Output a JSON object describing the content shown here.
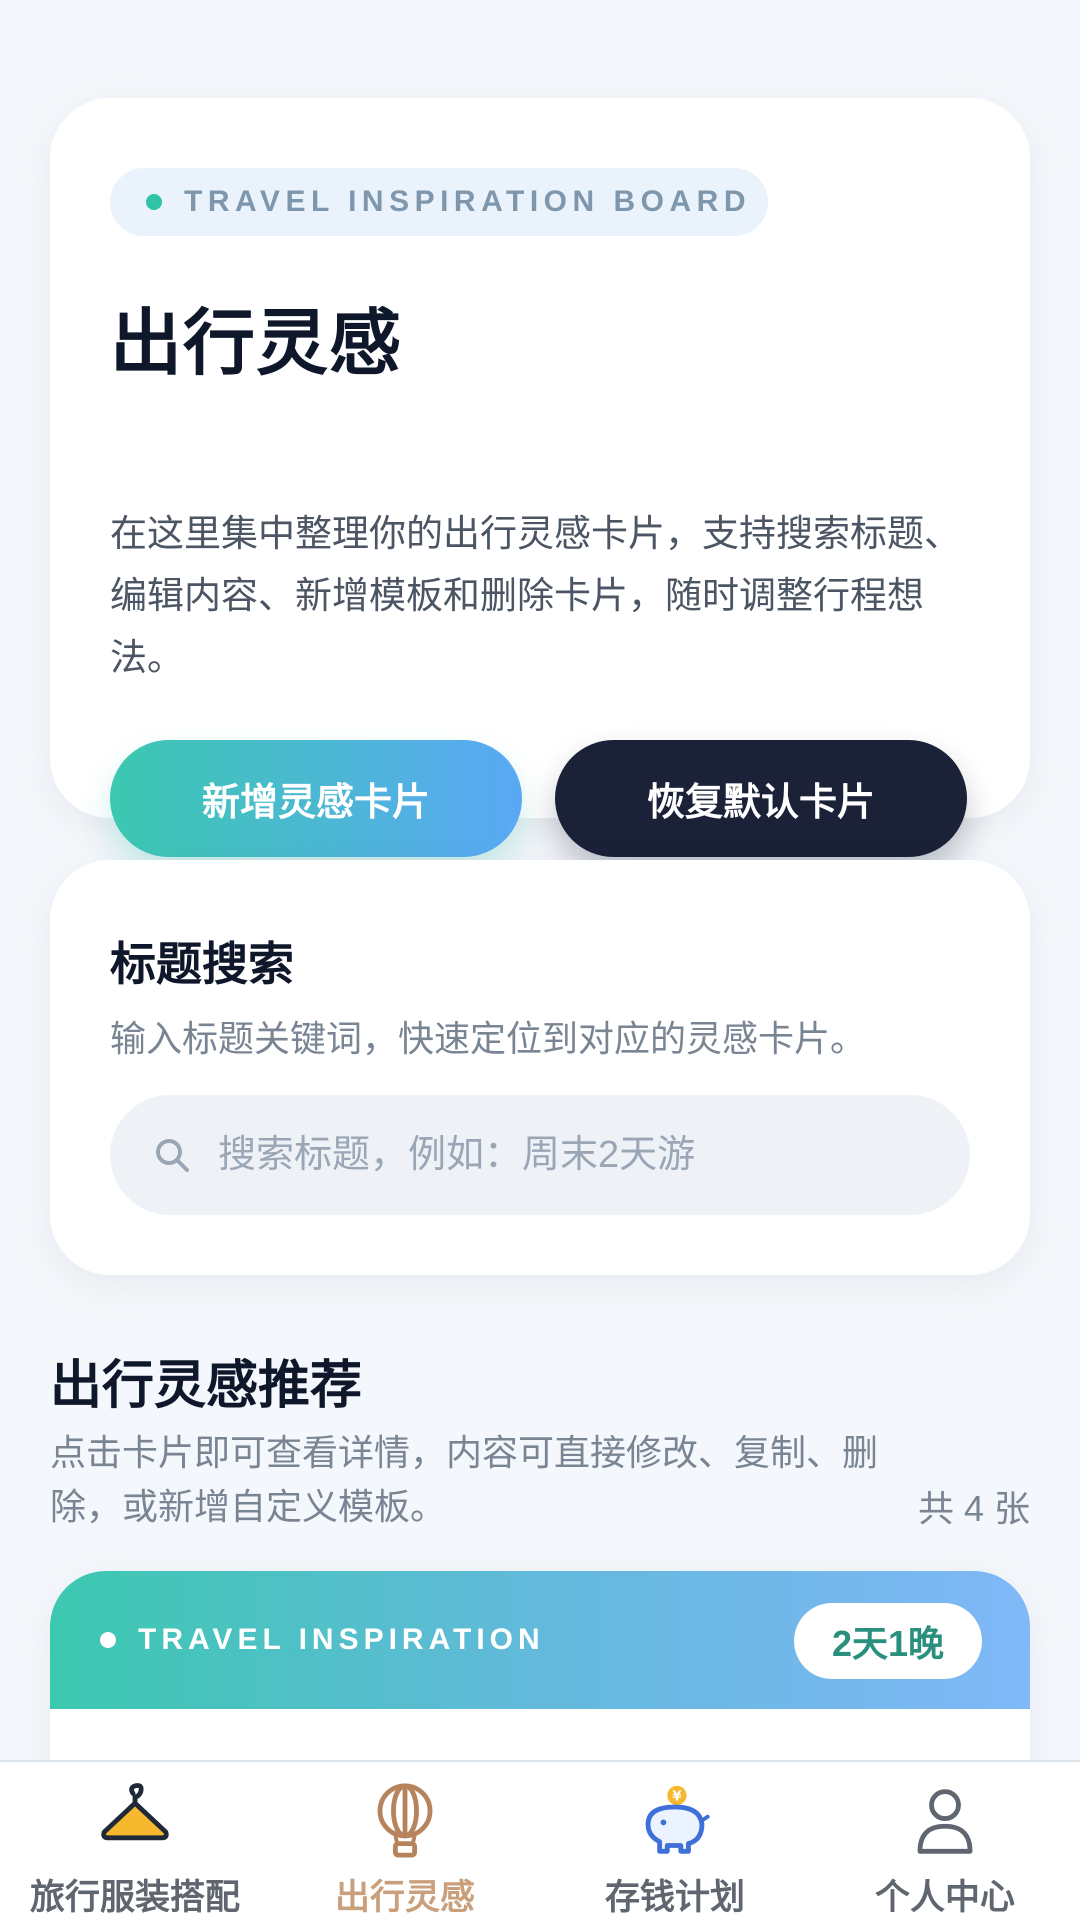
{
  "hero": {
    "badge": "TRAVEL INSPIRATION BOARD",
    "title": "出行灵感",
    "description": "在这里集中整理你的出行灵感卡片，支持搜索标题、编辑内容、新增模板和删除卡片，随时调整行程想法。",
    "add_button": "新增灵感卡片",
    "reset_button": "恢复默认卡片"
  },
  "search": {
    "title": "标题搜索",
    "subtitle": "输入标题关键词，快速定位到对应的灵感卡片。",
    "placeholder": "搜索标题，例如：周末2天游",
    "value": ""
  },
  "recommend": {
    "title": "出行灵感推荐",
    "description": "点击卡片即可查看详情，内容可直接修改、复制、删除，或新增自定义模板。",
    "count": "共 4 张"
  },
  "cards": [
    {
      "label": "TRAVEL INSPIRATION",
      "duration": "2天1晚"
    }
  ],
  "tabbar": {
    "items": [
      {
        "label": "旅行服装搭配",
        "icon": "hanger-icon",
        "active": false
      },
      {
        "label": "出行灵感",
        "icon": "hot-air-balloon-icon",
        "active": true
      },
      {
        "label": "存钱计划",
        "icon": "piggy-bank-icon",
        "active": false
      },
      {
        "label": "个人中心",
        "icon": "user-icon",
        "active": false
      }
    ]
  },
  "colors": {
    "accent_teal": "#3cc8b0",
    "accent_blue": "#5aa8f5",
    "dark_button": "#1b2238",
    "active_tab": "#caa07c",
    "page_bg": "#f4f7fb"
  }
}
